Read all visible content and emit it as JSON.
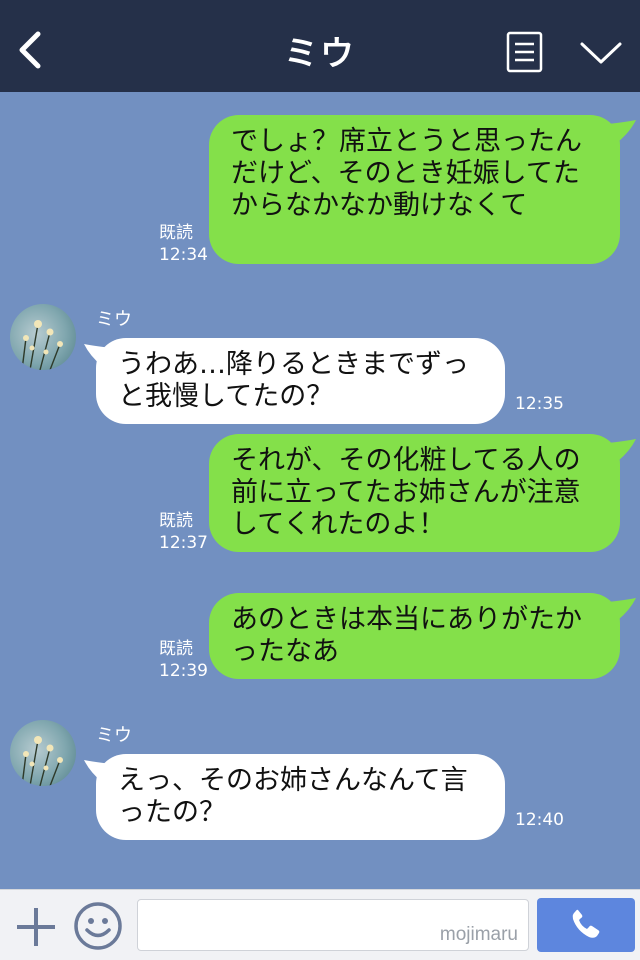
{
  "header": {
    "title": "ミウ",
    "bg_color": "#253049"
  },
  "chat": {
    "bg_color": "#7290c1",
    "messages": [
      {
        "from": "me",
        "text": "でしょ？席立とうと思ったんだけど、そのとき妊娠してたからなかなか動けなくて",
        "status": "既読",
        "time": "12:34"
      },
      {
        "from": "them",
        "sender": "ミウ",
        "text": "うわあ…降りるときまでずっと我慢してたの？",
        "time": "12:35"
      },
      {
        "from": "me",
        "text": "それが、その化粧してる人の前に立ってたお姉さんが注意してくれたのよ！",
        "status": "既読",
        "time": "12:37"
      },
      {
        "from": "me",
        "text": "あのときは本当にありがたかったなあ",
        "status": "既読",
        "time": "12:39"
      },
      {
        "from": "them",
        "sender": "ミウ",
        "text": "えっ、そのお姉さんなんて言ったの？",
        "time": "12:40"
      }
    ],
    "my_bubble_color": "#84e04a",
    "their_bubble_color": "#ffffff"
  },
  "input": {
    "placeholder": "",
    "watermark": "mojimaru",
    "send_color": "#5d86de"
  },
  "icons": {
    "back": "chevron-left-icon",
    "menu": "list-menu-icon",
    "collapse": "chevron-down-icon",
    "plus": "plus-icon",
    "emoji": "smiley-icon",
    "call": "phone-icon"
  }
}
